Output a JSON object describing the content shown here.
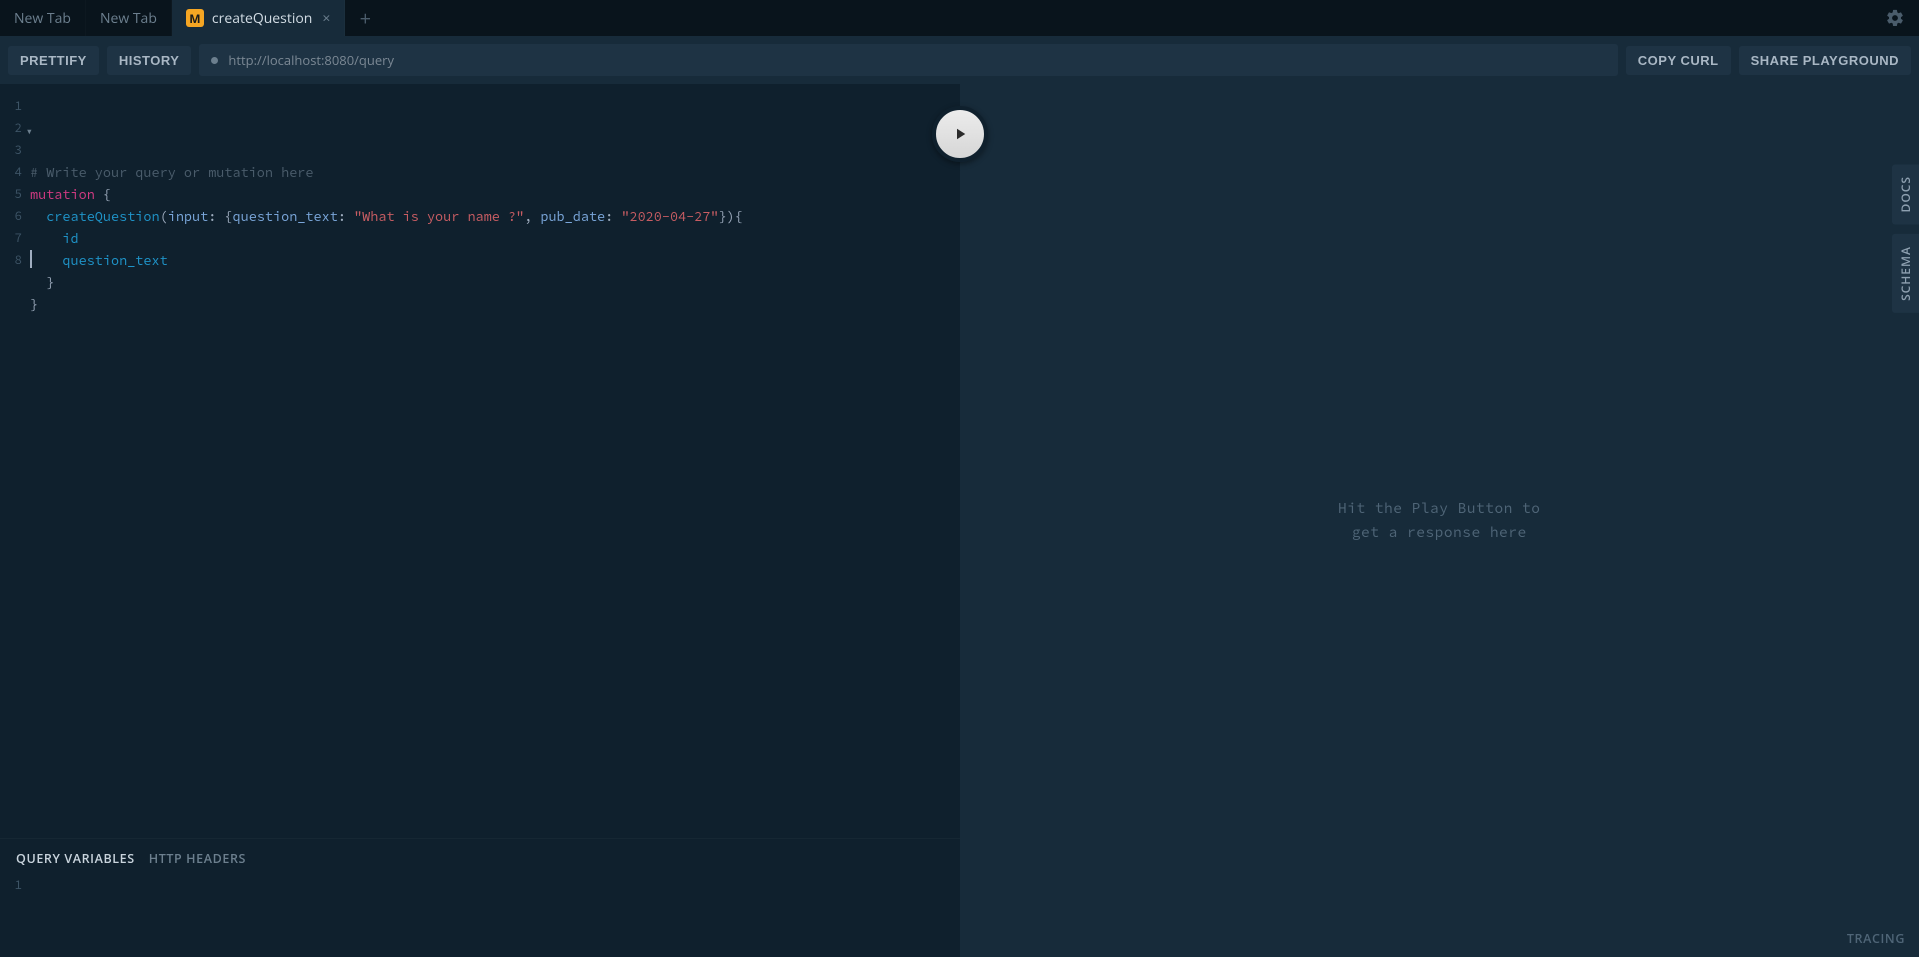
{
  "tabs": [
    {
      "label": "New Tab",
      "active": false,
      "badge": null
    },
    {
      "label": "New Tab",
      "active": false,
      "badge": null
    },
    {
      "label": "createQuestion",
      "active": true,
      "badge": "M"
    }
  ],
  "toolbar": {
    "prettify": "PRETTIFY",
    "history": "HISTORY",
    "url": "http://localhost:8080/query",
    "copy_curl": "COPY CURL",
    "share": "SHARE PLAYGROUND"
  },
  "editor": {
    "lines": [
      "1",
      "2",
      "3",
      "4",
      "5",
      "6",
      "7",
      "8"
    ],
    "code_tokens": [
      [
        {
          "cls": "c-comment",
          "t": "# Write your query or mutation here"
        }
      ],
      [
        {
          "cls": "c-keyword",
          "t": "mutation"
        },
        {
          "cls": "c-punc",
          "t": " {"
        }
      ],
      [
        {
          "cls": "",
          "t": "  "
        },
        {
          "cls": "c-field",
          "t": "createQuestion"
        },
        {
          "cls": "c-punc",
          "t": "("
        },
        {
          "cls": "c-attr",
          "t": "input"
        },
        {
          "cls": "c-punc",
          "t": ": {"
        },
        {
          "cls": "c-attr",
          "t": "question_text"
        },
        {
          "cls": "c-punc",
          "t": ": "
        },
        {
          "cls": "c-string",
          "t": "\"What is your name ?\""
        },
        {
          "cls": "c-punc",
          "t": ", "
        },
        {
          "cls": "c-attr",
          "t": "pub_date"
        },
        {
          "cls": "c-punc",
          "t": ": "
        },
        {
          "cls": "c-string",
          "t": "\"2020-04-27\""
        },
        {
          "cls": "c-punc",
          "t": "}){"
        }
      ],
      [
        {
          "cls": "",
          "t": "    "
        },
        {
          "cls": "c-field",
          "t": "id"
        }
      ],
      [
        {
          "cls": "",
          "t": "    "
        },
        {
          "cls": "c-field",
          "t": "question_text"
        }
      ],
      [
        {
          "cls": "",
          "t": "  "
        },
        {
          "cls": "c-punc",
          "t": "}"
        }
      ],
      [
        {
          "cls": "c-punc",
          "t": "}"
        }
      ],
      [
        {
          "cls": "",
          "t": ""
        }
      ]
    ]
  },
  "vars": {
    "tab_query_variables": "QUERY VARIABLES",
    "tab_http_headers": "HTTP HEADERS",
    "line1": "1"
  },
  "response": {
    "placeholder_line1": "Hit the Play Button to",
    "placeholder_line2": "get a response here",
    "tracing": "TRACING"
  },
  "side": {
    "docs": "DOCS",
    "schema": "SCHEMA"
  }
}
